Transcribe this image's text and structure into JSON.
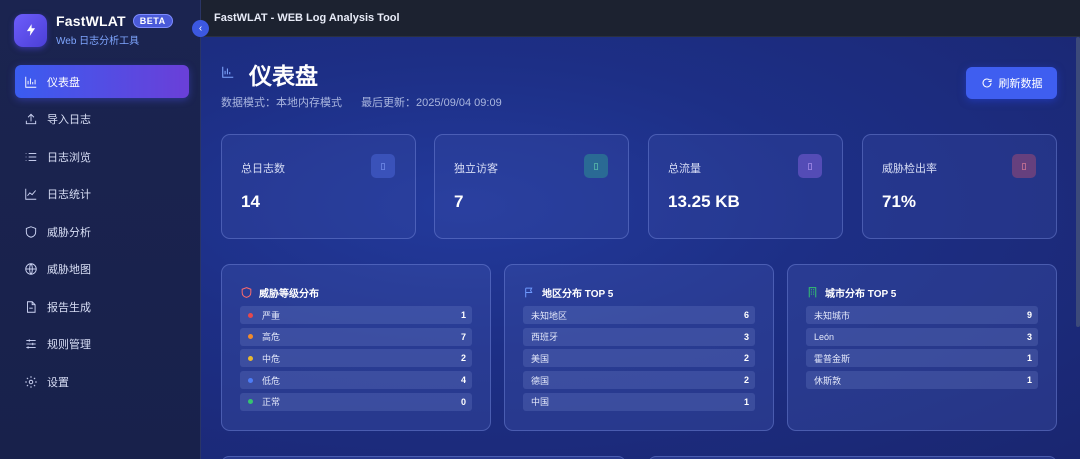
{
  "brand": {
    "name": "FastWLAT",
    "badge": "BETA",
    "subtitle": "Web 日志分析工具",
    "logo_icon": "lightning-icon"
  },
  "topbar": {
    "title": "FastWLAT - WEB Log Analysis Tool"
  },
  "sidebar": {
    "items": [
      {
        "label": "仪表盘",
        "icon": "bar-chart-icon",
        "active": true
      },
      {
        "label": "导入日志",
        "icon": "upload-icon",
        "active": false
      },
      {
        "label": "日志浏览",
        "icon": "list-icon",
        "active": false
      },
      {
        "label": "日志统计",
        "icon": "trend-icon",
        "active": false
      },
      {
        "label": "威胁分析",
        "icon": "shield-icon",
        "active": false
      },
      {
        "label": "威胁地图",
        "icon": "globe-icon",
        "active": false
      },
      {
        "label": "报告生成",
        "icon": "document-icon",
        "active": false
      },
      {
        "label": "规则管理",
        "icon": "sliders-icon",
        "active": false
      },
      {
        "label": "设置",
        "icon": "gear-icon",
        "active": false
      }
    ]
  },
  "page": {
    "title": "仪表盘",
    "data_mode": "数据模式：本地内存模式",
    "last_update": "最后更新：2025/09/04 09:09",
    "refresh_label": "刷新数据"
  },
  "stats": [
    {
      "label": "总日志数",
      "value": "14",
      "icon": "file-icon",
      "color": "#5b7cf5"
    },
    {
      "label": "独立访客",
      "value": "7",
      "icon": "users-icon",
      "color": "#2fbf8f"
    },
    {
      "label": "总流量",
      "value": "13.25 KB",
      "icon": "database-icon",
      "color": "#9a6cf0"
    },
    {
      "label": "威胁检出率",
      "value": "71%",
      "icon": "warning-icon",
      "color": "#e0566a"
    }
  ],
  "threat_levels": {
    "title": "威胁等级分布",
    "rows": [
      {
        "label": "严重",
        "count": "1",
        "color": "#e5484d"
      },
      {
        "label": "高危",
        "count": "7",
        "color": "#f08a2c"
      },
      {
        "label": "中危",
        "count": "2",
        "color": "#e8b92f"
      },
      {
        "label": "低危",
        "count": "4",
        "color": "#4d7cf5"
      },
      {
        "label": "正常",
        "count": "0",
        "color": "#35c46f"
      }
    ]
  },
  "regions": {
    "title": "地区分布 TOP 5",
    "rows": [
      {
        "label": "未知地区",
        "count": "6"
      },
      {
        "label": "西班牙",
        "count": "3"
      },
      {
        "label": "美国",
        "count": "2"
      },
      {
        "label": "德国",
        "count": "2"
      },
      {
        "label": "中国",
        "count": "1"
      }
    ]
  },
  "cities": {
    "title": "城市分布 TOP 5",
    "rows": [
      {
        "label": "未知城市",
        "count": "9"
      },
      {
        "label": "León",
        "count": "3"
      },
      {
        "label": "霍普金斯",
        "count": "1"
      },
      {
        "label": "休斯敦",
        "count": "1"
      }
    ]
  }
}
